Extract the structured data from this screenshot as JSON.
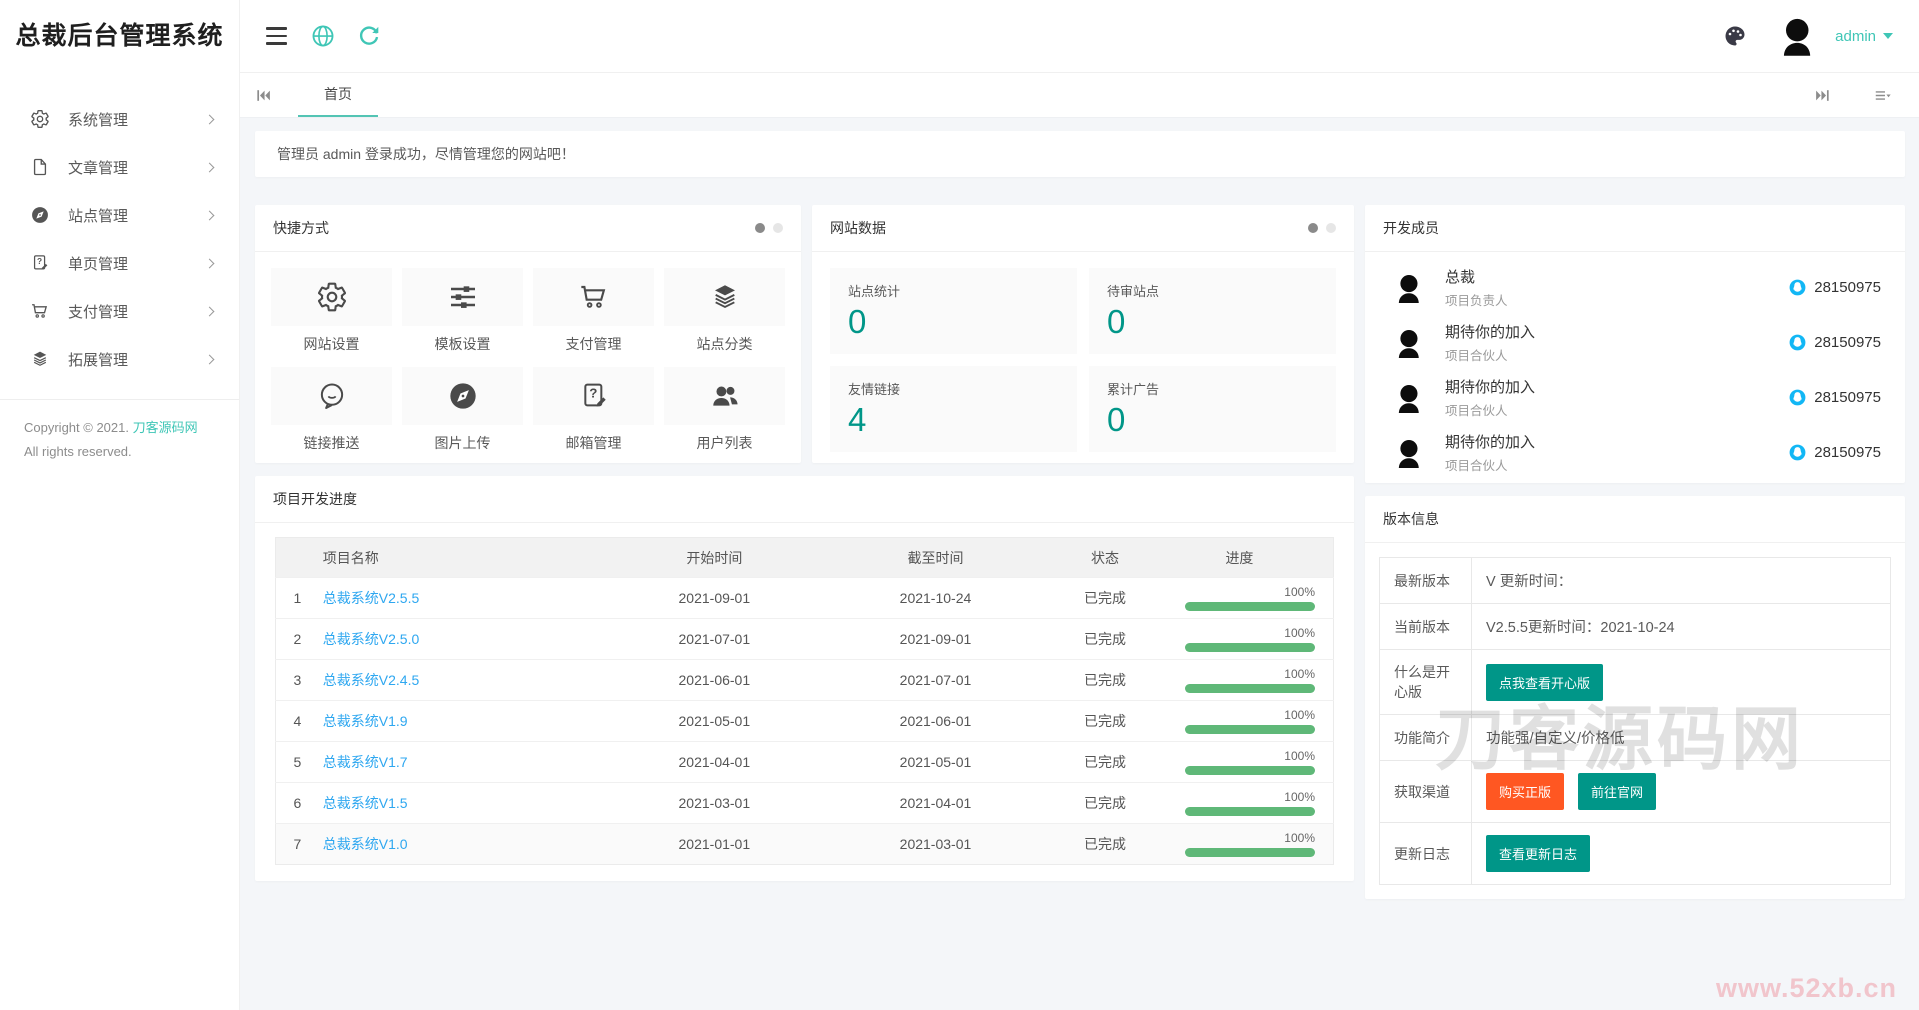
{
  "app": {
    "title": "总裁后台管理系统"
  },
  "header": {
    "user": "admin"
  },
  "sidebar": {
    "menu": [
      {
        "label": "系统管理",
        "icon": "gear-icon"
      },
      {
        "label": "文章管理",
        "icon": "file-icon"
      },
      {
        "label": "站点管理",
        "icon": "compass-icon"
      },
      {
        "label": "单页管理",
        "icon": "page-question-icon"
      },
      {
        "label": "支付管理",
        "icon": "cart-icon"
      },
      {
        "label": "拓展管理",
        "icon": "layers-icon"
      }
    ],
    "copyright_prefix": "Copyright © 2021.",
    "copyright_link": "刀客源码网",
    "rights": "All rights reserved."
  },
  "tabbar": {
    "home": "首页"
  },
  "welcome": {
    "message": "管理员 admin 登录成功，尽情管理您的网站吧！"
  },
  "shortcuts": {
    "title": "快捷方式",
    "items": [
      {
        "label": "网站设置",
        "icon": "gear-icon"
      },
      {
        "label": "模板设置",
        "icon": "sliders-icon"
      },
      {
        "label": "支付管理",
        "icon": "cart-icon"
      },
      {
        "label": "站点分类",
        "icon": "layers-icon"
      },
      {
        "label": "链接推送",
        "icon": "chat-bubble-icon"
      },
      {
        "label": "图片上传",
        "icon": "compass-icon"
      },
      {
        "label": "邮箱管理",
        "icon": "page-question-icon"
      },
      {
        "label": "用户列表",
        "icon": "users-icon"
      }
    ]
  },
  "site_stats": {
    "title": "网站数据",
    "cards": [
      {
        "label": "站点统计",
        "value": "0"
      },
      {
        "label": "待审站点",
        "value": "0"
      },
      {
        "label": "友情链接",
        "value": "4"
      },
      {
        "label": "累计广告",
        "value": "0"
      }
    ]
  },
  "members": {
    "title": "开发成员",
    "rows": [
      {
        "name": "总裁",
        "role": "项目负责人",
        "qq": "28150975"
      },
      {
        "name": "期待你的加入",
        "role": "项目合伙人",
        "qq": "28150975"
      },
      {
        "name": "期待你的加入",
        "role": "项目合伙人",
        "qq": "28150975"
      },
      {
        "name": "期待你的加入",
        "role": "项目合伙人",
        "qq": "28150975"
      }
    ]
  },
  "projects": {
    "title": "项目开发进度",
    "headers": {
      "name": "项目名称",
      "start": "开始时间",
      "end": "截至时间",
      "status": "状态",
      "progress": "进度"
    },
    "rows": [
      {
        "index": "1",
        "name": "总裁系统V2.5.5",
        "start": "2021-09-01",
        "end": "2021-10-24",
        "status": "已完成",
        "status_type": "danger",
        "progress": "100%"
      },
      {
        "index": "2",
        "name": "总裁系统V2.5.0",
        "start": "2021-07-01",
        "end": "2021-09-01",
        "status": "已完成",
        "status_type": "success",
        "progress": "100%"
      },
      {
        "index": "3",
        "name": "总裁系统V2.4.5",
        "start": "2021-06-01",
        "end": "2021-07-01",
        "status": "已完成",
        "status_type": "success",
        "progress": "100%"
      },
      {
        "index": "4",
        "name": "总裁系统V1.9",
        "start": "2021-05-01",
        "end": "2021-06-01",
        "status": "已完成",
        "status_type": "success",
        "progress": "100%"
      },
      {
        "index": "5",
        "name": "总裁系统V1.7",
        "start": "2021-04-01",
        "end": "2021-05-01",
        "status": "已完成",
        "status_type": "success",
        "progress": "100%"
      },
      {
        "index": "6",
        "name": "总裁系统V1.5",
        "start": "2021-03-01",
        "end": "2021-04-01",
        "status": "已完成",
        "status_type": "success",
        "progress": "100%"
      },
      {
        "index": "7",
        "name": "总裁系统V1.0",
        "start": "2021-01-01",
        "end": "2021-03-01",
        "status": "已完成",
        "status_type": "success",
        "progress": "100%"
      }
    ]
  },
  "version": {
    "title": "版本信息",
    "latest_label": "最新版本",
    "latest_value": "V 更新时间：",
    "current_label": "当前版本",
    "current_value": "V2.5.5更新时间：2021-10-24",
    "happy_label": "什么是开心版",
    "happy_button": "点我查看开心版",
    "features_label": "功能简介",
    "features_value": "功能强/自定义/价格低",
    "channel_label": "获取渠道",
    "buy_button": "购买正版",
    "official_button": "前往官网",
    "log_label": "更新日志",
    "log_button": "查看更新日志"
  },
  "watermarks": {
    "panel": "刀客源码网",
    "corner": "www.52xb.cn"
  },
  "colors": {
    "accent_teal": "#3fc6b6",
    "button_teal": "#009688",
    "green": "#5FB878",
    "orange": "#FF5722",
    "status_red": "#fb5a51",
    "link_blue": "#2ea7f0",
    "qq_blue": "#12B7F5"
  }
}
